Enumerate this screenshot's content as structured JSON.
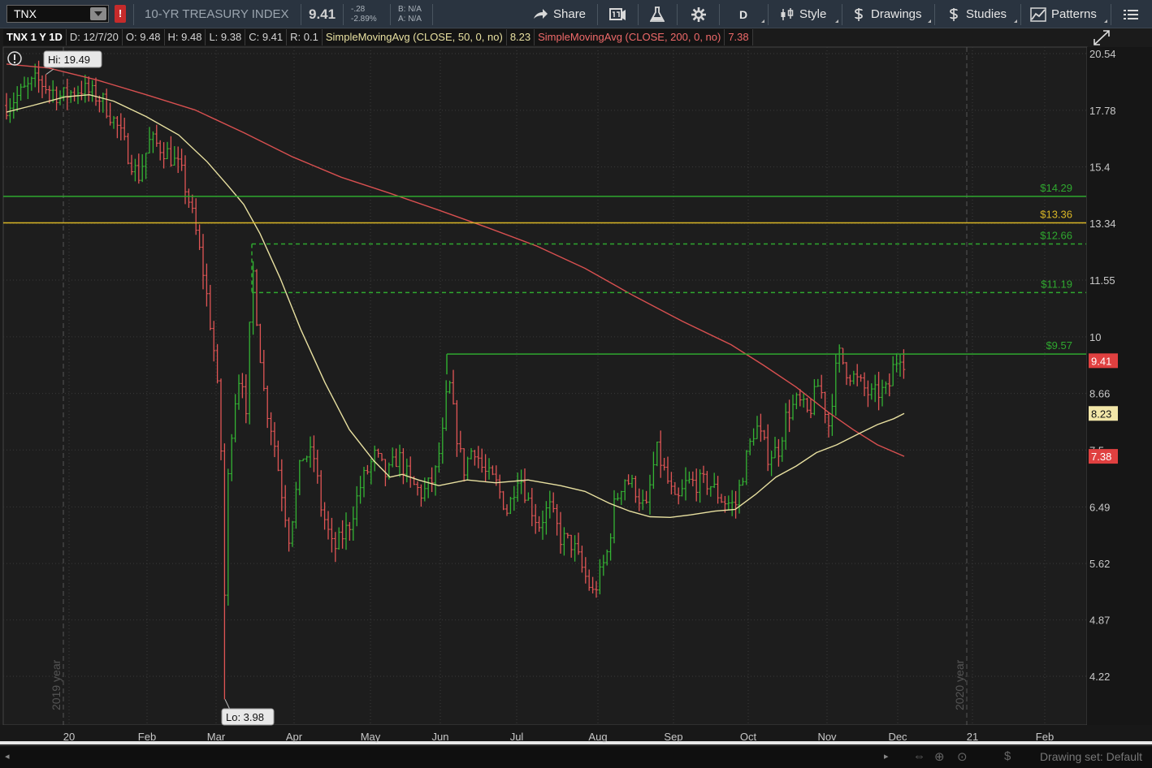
{
  "toolbar": {
    "symbol": "TNX",
    "alert_mark": "!",
    "description": "10-YR TREASURY INDEX",
    "last": "9.41",
    "change": "-.28",
    "change_pct": "-2.89%",
    "bid": "B: N/A",
    "ask": "A: N/A",
    "share_label": "Share",
    "aggregation_label": "D",
    "style_label": "Style",
    "drawings_label": "Drawings",
    "studies_label": "Studies",
    "patterns_label": "Patterns"
  },
  "infobar": {
    "symbol_period": "TNX 1 Y 1D",
    "date": "D: 12/7/20",
    "open": "O: 9.48",
    "high": "H: 9.48",
    "low": "L: 9.38",
    "close": "C: 9.41",
    "range": "R: 0.1",
    "sma50_label": "SimpleMovingAvg (CLOSE, 50, 0, no)",
    "sma50_value": "8.23",
    "sma200_label": "SimpleMovingAvg (CLOSE, 200, 0, no)",
    "sma200_value": "7.38"
  },
  "chart": {
    "price_ticks": [
      "20.54",
      "17.78",
      "15.4",
      "13.34",
      "11.55",
      "10",
      "8.66",
      "7.5",
      "6.49",
      "5.62",
      "4.87",
      "4.22"
    ],
    "time_ticks": [
      "20",
      "Feb",
      "Mar",
      "Apr",
      "May",
      "Jun",
      "Jul",
      "Aug",
      "Sep",
      "Oct",
      "Nov",
      "Dec",
      "21",
      "Feb"
    ],
    "year_labels": [
      "2019 year",
      "2020 year"
    ],
    "hi_label": "Hi: 19.49",
    "lo_label": "Lo: 3.98",
    "levels": [
      {
        "label": "$14.29",
        "value": 14.29,
        "style": "solid",
        "color": "#2fa82f"
      },
      {
        "label": "$13.36",
        "value": 13.36,
        "style": "solid",
        "color": "#d9b626"
      },
      {
        "label": "$12.66",
        "value": 12.66,
        "style": "dashed",
        "color": "#2fa82f"
      },
      {
        "label": "$11.19",
        "value": 11.19,
        "style": "dashed",
        "color": "#2fa82f"
      },
      {
        "label": "$9.57",
        "value": 9.57,
        "style": "solid",
        "color": "#2fa82f"
      }
    ],
    "price_badge": "9.41",
    "sma50_badge": "8.23",
    "sma200_badge": "7.38",
    "colors": {
      "up": "#34b334",
      "down": "#e05555",
      "sma50": "#e8e0a0",
      "sma200": "#d85050",
      "grid": "#3a3a3a"
    }
  },
  "footer": {
    "drawing_set": "Drawing set: Default"
  }
}
